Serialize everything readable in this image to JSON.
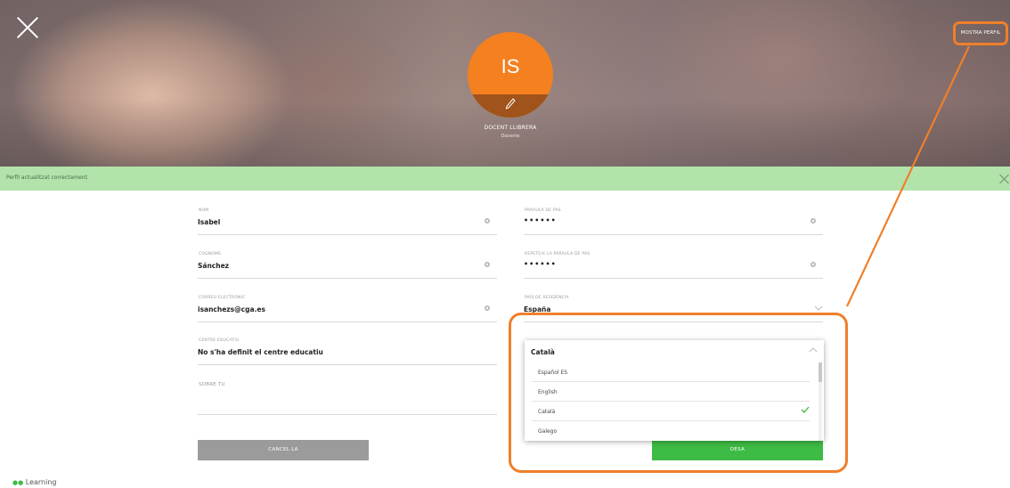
{
  "header": {
    "avatar_initials": "IS",
    "role_name": "DOCENT LLIBRERA",
    "role_sub": "Docente",
    "show_profile_label": "MOSTRA PERFIL"
  },
  "banner": {
    "message": "Perfil actualitzat correctament."
  },
  "form": {
    "nom": {
      "label": "NOM",
      "value": "Isabel"
    },
    "cognoms": {
      "label": "COGNOMS",
      "value": "Sánchez"
    },
    "correu": {
      "label": "CORREU ELECTRÒNIC",
      "value": "isanchezs@cga.es"
    },
    "centre": {
      "label": "CENTRE EDUCATIU",
      "value": "No s'ha definit el centre educatiu"
    },
    "sobre": {
      "label": "SOBRE TU",
      "value": ""
    },
    "paraula": {
      "label": "PARAULA DE PAS",
      "value": "••••••"
    },
    "repetir": {
      "label": "REPETEIX LA PARAULA DE PAS",
      "value": "••••••"
    },
    "pais": {
      "label": "PAÍS DE RESIDÈNCIA",
      "value": "España"
    }
  },
  "language_dropdown": {
    "selected": "Català",
    "options": [
      "Español ES",
      "English",
      "Català",
      "Galego"
    ]
  },
  "buttons": {
    "cancel": "CANCEL·LA",
    "save": "DESA"
  },
  "footer": {
    "logo_text": "Learning"
  },
  "colors": {
    "accent_orange": "#f07f2a",
    "avatar": "#f4801f",
    "success": "#3dbb44",
    "banner": "#b2e3ab"
  }
}
